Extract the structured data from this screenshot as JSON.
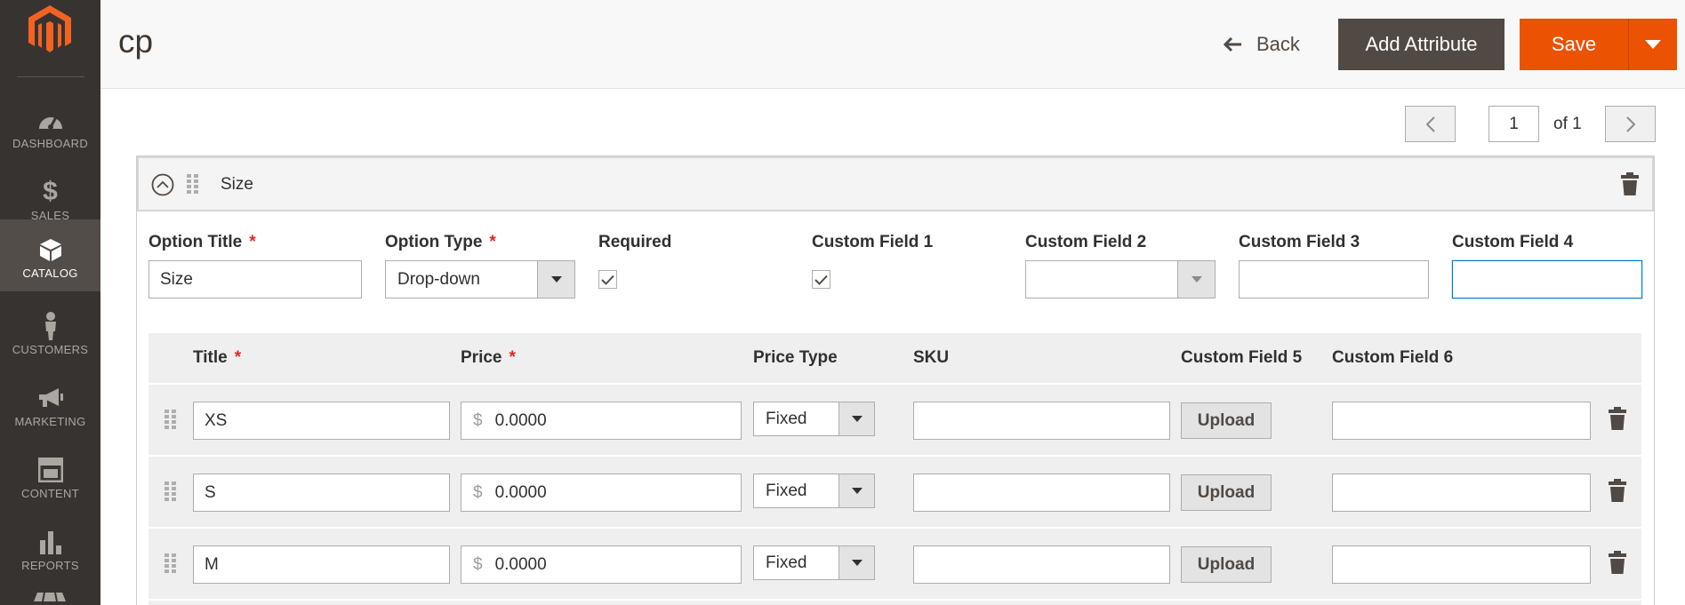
{
  "sidebar": {
    "items": [
      {
        "key": "dashboard",
        "label": "DASHBOARD",
        "active": false
      },
      {
        "key": "sales",
        "label": "SALES",
        "active": false
      },
      {
        "key": "catalog",
        "label": "CATALOG",
        "active": true
      },
      {
        "key": "customers",
        "label": "CUSTOMERS",
        "active": false
      },
      {
        "key": "marketing",
        "label": "MARKETING",
        "active": false
      },
      {
        "key": "content",
        "label": "CONTENT",
        "active": false
      },
      {
        "key": "reports",
        "label": "REPORTS",
        "active": false
      }
    ]
  },
  "header": {
    "title": "cp",
    "back_label": "Back",
    "add_attribute_label": "Add Attribute",
    "save_label": "Save"
  },
  "pager": {
    "current_page": "1",
    "of_label": "of 1"
  },
  "option": {
    "name": "Size",
    "labels": {
      "option_title": "Option Title",
      "option_type": "Option Type",
      "required": "Required",
      "custom_field_1": "Custom Field 1",
      "custom_field_2": "Custom Field 2",
      "custom_field_3": "Custom Field 3",
      "custom_field_4": "Custom Field 4",
      "required_marker": "*"
    },
    "values": {
      "option_title": "Size",
      "option_type": "Drop-down",
      "required_checked": true,
      "custom_field_1_checked": true,
      "custom_field_2": "",
      "custom_field_3": "",
      "custom_field_4": ""
    }
  },
  "table": {
    "headers": {
      "title": "Title",
      "price": "Price",
      "price_type": "Price Type",
      "sku": "SKU",
      "custom_field_5": "Custom Field 5",
      "custom_field_6": "Custom Field 6"
    },
    "currency_symbol": "$",
    "upload_label": "Upload",
    "rows": [
      {
        "title": "XS",
        "price": "0.0000",
        "price_type": "Fixed",
        "sku": "",
        "custom_field_6": ""
      },
      {
        "title": "S",
        "price": "0.0000",
        "price_type": "Fixed",
        "sku": "",
        "custom_field_6": ""
      },
      {
        "title": "M",
        "price": "0.0000",
        "price_type": "Fixed",
        "sku": "",
        "custom_field_6": ""
      }
    ]
  },
  "colors": {
    "sidebar_bg": "#373330",
    "sidebar_active": "#524d49",
    "save_orange": "#eb5202",
    "add_attribute_bg": "#514943",
    "required_red": "#e22626",
    "logo_orange": "#f26322"
  },
  "icons": {
    "logo": "magento-logo",
    "back": "arrow-left-icon",
    "collapse": "chevron-up-circle-icon",
    "drag": "drag-handle-icon",
    "delete": "trash-icon",
    "dropdown": "caret-down-icon"
  }
}
